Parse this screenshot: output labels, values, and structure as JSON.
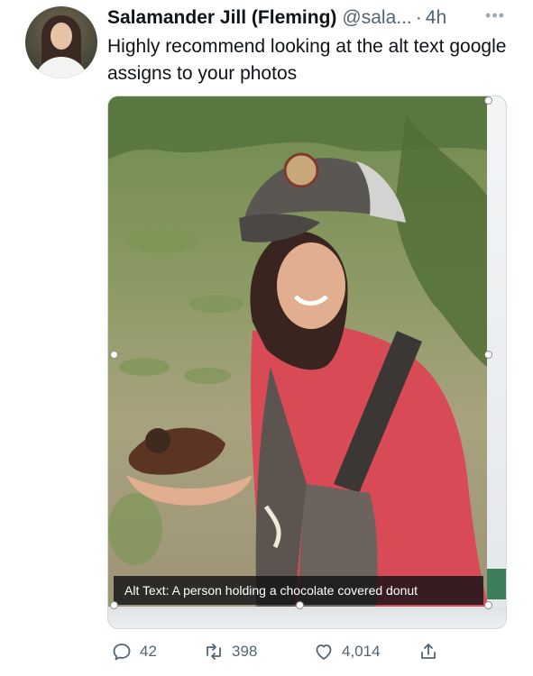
{
  "author": {
    "display_name": "Salamander Jill (Fleming)",
    "handle": "@sala...",
    "separator": "·",
    "time": "4h"
  },
  "more_menu": {
    "glyph": "•••",
    "icon": "more-horizontal-icon"
  },
  "tweet": {
    "text": "Highly recommend looking at the alt text google assigns to your photos"
  },
  "media": {
    "alt_text_label": "Alt Text: A person holding a chocolate covered donut"
  },
  "actions": {
    "reply": {
      "icon": "reply-icon",
      "count": "42"
    },
    "retweet": {
      "icon": "retweet-icon",
      "count": "398"
    },
    "like": {
      "icon": "heart-icon",
      "count": "4,014"
    },
    "share": {
      "icon": "share-icon"
    }
  },
  "colors": {
    "text": "#0f1419",
    "muted": "#536471",
    "border": "#cfd9de",
    "shirt": "#d84a55",
    "cap": "#5a5652"
  }
}
